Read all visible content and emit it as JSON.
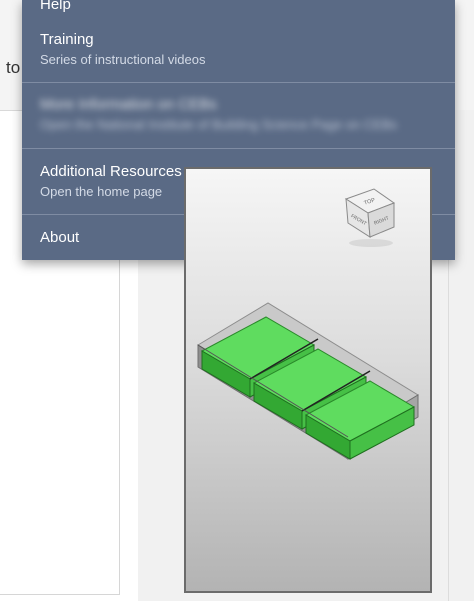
{
  "background": {
    "text_fragment": "to"
  },
  "help_menu": {
    "items": [
      {
        "title": "Help",
        "subtitle": ""
      },
      {
        "title": "Training",
        "subtitle": "Series of instructional videos"
      },
      {
        "title": "More Information on CEBs",
        "subtitle": "Open the National Institute of Building Science Page on CEBs",
        "blurred": true
      },
      {
        "title": "Additional Resources",
        "subtitle": "Open the home page"
      },
      {
        "title": "About",
        "subtitle": ""
      }
    ]
  },
  "viewcube": {
    "faces": [
      "TOP",
      "FRONT",
      "RIGHT"
    ]
  },
  "model_view": {
    "fill_color": "#4ed14e",
    "frame_color": "#9a9a9a",
    "cells": 3
  }
}
